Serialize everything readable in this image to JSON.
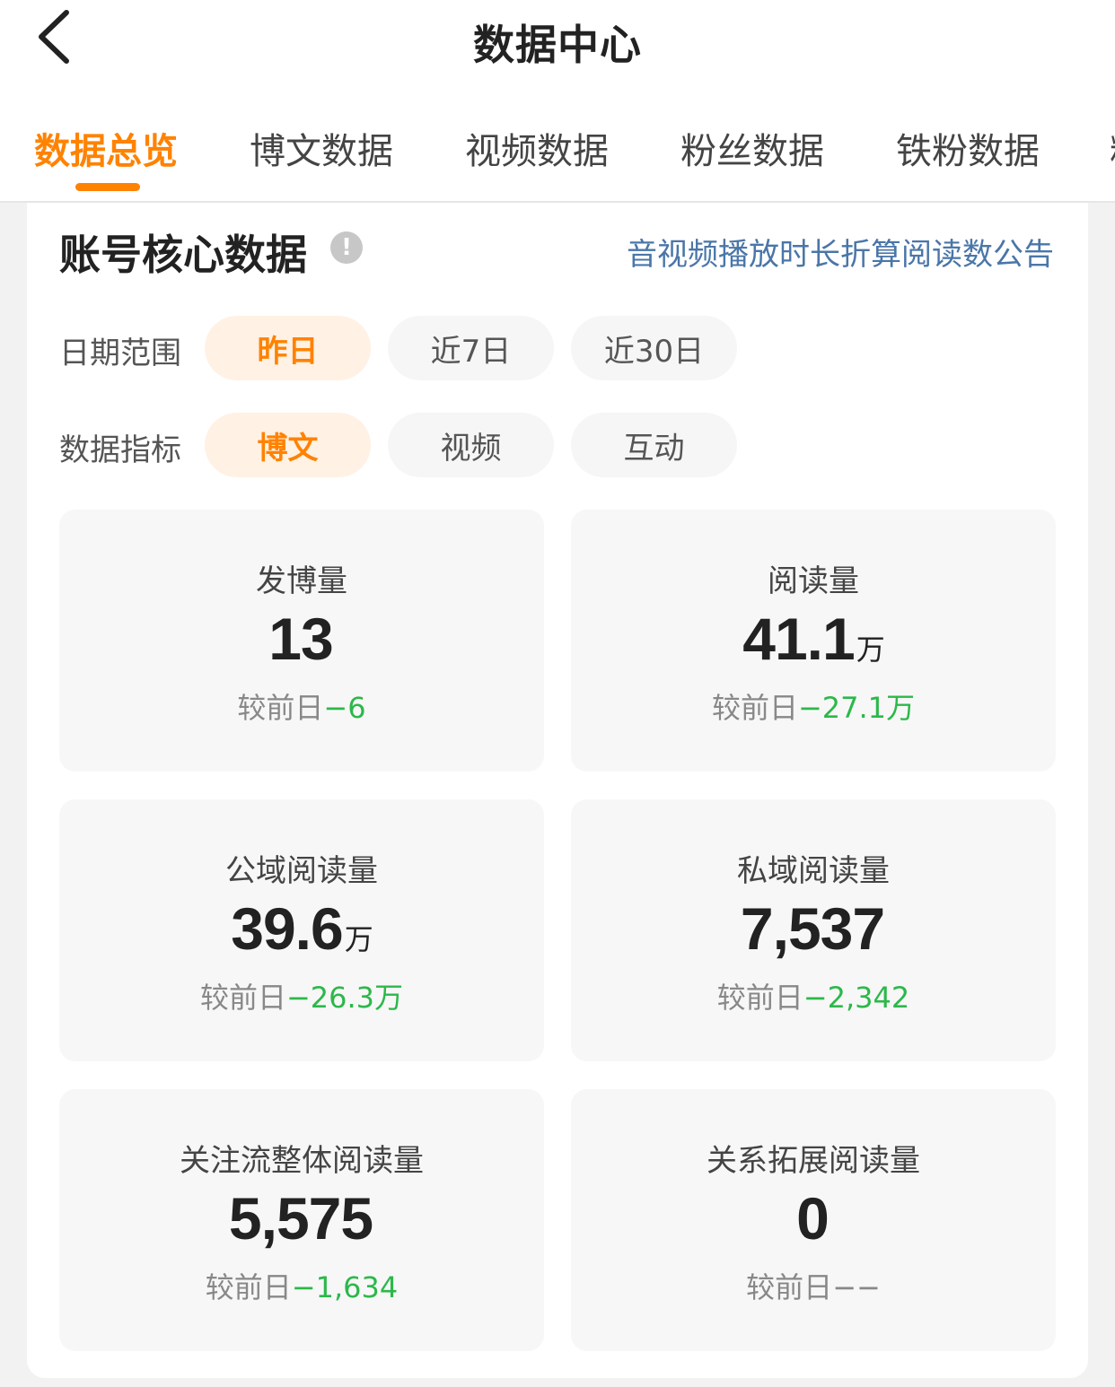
{
  "header": {
    "title": "数据中心"
  },
  "tabs": [
    {
      "label": "数据总览",
      "active": true
    },
    {
      "label": "博文数据",
      "active": false
    },
    {
      "label": "视频数据",
      "active": false
    },
    {
      "label": "粉丝数据",
      "active": false
    },
    {
      "label": "铁粉数据",
      "active": false
    },
    {
      "label": "粉",
      "active": false
    }
  ],
  "section": {
    "title": "账号核心数据",
    "info_icon": "!",
    "notice_link": "音视频播放时长折算阅读数公告"
  },
  "filters": {
    "date_label": "日期范围",
    "date_options": [
      "昨日",
      "近7日",
      "近30日"
    ],
    "date_selected": "昨日",
    "metric_label": "数据指标",
    "metric_options": [
      "博文",
      "视频",
      "互动"
    ],
    "metric_selected": "博文"
  },
  "stats": [
    {
      "label": "发博量",
      "value": "13",
      "unit": "",
      "cmp_prefix": "较前日",
      "delta": "−6"
    },
    {
      "label": "阅读量",
      "value": "41.1",
      "unit": "万",
      "cmp_prefix": "较前日",
      "delta": "−27.1万"
    },
    {
      "label": "公域阅读量",
      "value": "39.6",
      "unit": "万",
      "cmp_prefix": "较前日",
      "delta": "−26.3万"
    },
    {
      "label": "私域阅读量",
      "value": "7,537",
      "unit": "",
      "cmp_prefix": "较前日",
      "delta": "−2,342"
    },
    {
      "label": "关注流整体阅读量",
      "value": "5,575",
      "unit": "",
      "cmp_prefix": "较前日",
      "delta": "−1,634"
    },
    {
      "label": "关系拓展阅读量",
      "value": "0",
      "unit": "",
      "cmp_prefix": "较前日",
      "delta": "−−"
    }
  ],
  "colors": {
    "accent": "#ff8200",
    "link": "#4a76a8",
    "decrease": "#2cb84a"
  }
}
